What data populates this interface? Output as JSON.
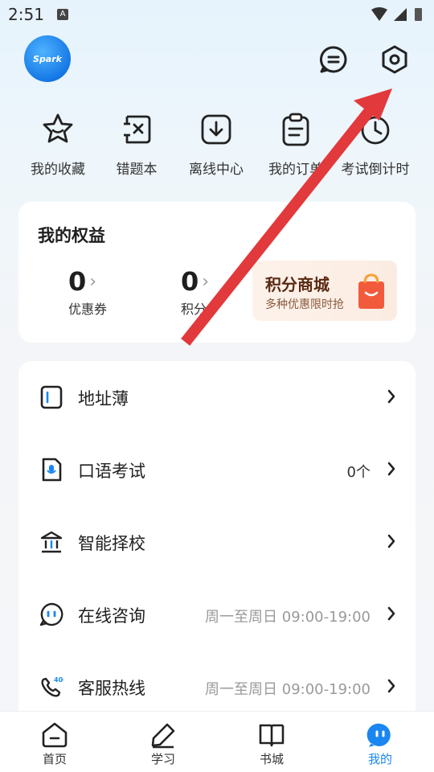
{
  "status_bar": {
    "time": "2:51",
    "notification_letter": "A"
  },
  "header": {
    "avatar_text": "Spark"
  },
  "quick_actions": [
    {
      "label": "我的收藏",
      "icon": "star-icon"
    },
    {
      "label": "错题本",
      "icon": "wrong-book-icon"
    },
    {
      "label": "离线中心",
      "icon": "download-icon"
    },
    {
      "label": "我的订单",
      "icon": "clipboard-icon"
    },
    {
      "label": "考试倒计时",
      "icon": "clock-icon"
    }
  ],
  "benefits": {
    "title": "我的权益",
    "coupons": {
      "value": "0",
      "label": "优惠券"
    },
    "points": {
      "value": "0",
      "label": "积分"
    },
    "mall": {
      "title": "积分商城",
      "subtitle": "多种优惠限时抢"
    }
  },
  "menu": [
    {
      "label": "地址薄",
      "value": "",
      "icon": "address-book-icon"
    },
    {
      "label": "口语考试",
      "value": "0个",
      "icon": "oral-exam-icon"
    },
    {
      "label": "智能择校",
      "value": "",
      "icon": "school-icon"
    },
    {
      "label": "在线咨询",
      "value": "周一至周日 09:00-19:00",
      "icon": "chat-icon"
    },
    {
      "label": "客服热线",
      "value": "周一至周日 09:00-19:00",
      "icon": "phone-icon"
    }
  ],
  "tabs": [
    {
      "label": "首页",
      "icon": "home-icon"
    },
    {
      "label": "学习",
      "icon": "pencil-icon"
    },
    {
      "label": "书城",
      "icon": "book-icon"
    },
    {
      "label": "我的",
      "icon": "profile-icon",
      "active": true
    }
  ],
  "colors": {
    "accent": "#1a86f2",
    "annotation_arrow": "#e2393c"
  }
}
